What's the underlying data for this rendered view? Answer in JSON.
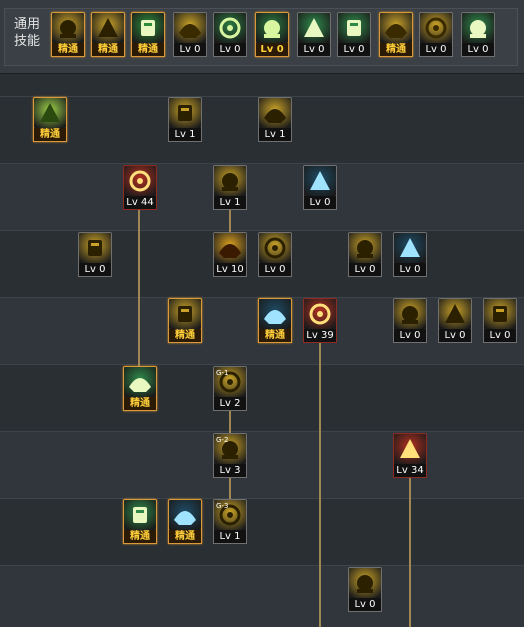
{
  "header": {
    "common_skills_label": "通用技能"
  },
  "common_skills": [
    {
      "name": "common-skill-1-icon",
      "label": "精通",
      "elite": true,
      "bg": "#c9a227",
      "fg": "#2b2100"
    },
    {
      "name": "common-skill-2-icon",
      "label": "精通",
      "elite": true,
      "bg": "#c9a227",
      "fg": "#2b2100"
    },
    {
      "name": "common-skill-3-icon",
      "label": "精通",
      "elite": true,
      "bg": "#2f8a3a",
      "fg": "#e9f7c0"
    },
    {
      "name": "common-skill-4-icon",
      "label": "Lv 0",
      "elite": false,
      "bg": "#c9a227",
      "fg": "#3a2a00"
    },
    {
      "name": "common-skill-5-icon",
      "label": "Lv 0",
      "elite": false,
      "bg": "#2b7a40",
      "fg": "#d8f5a0"
    },
    {
      "name": "common-skill-6-icon",
      "label": "Lv 0",
      "elite": true,
      "bg": "#2b7a40",
      "fg": "#d8f5a0"
    },
    {
      "name": "common-skill-7-icon",
      "label": "Lv 0",
      "elite": false,
      "bg": "#2f8a4a",
      "fg": "#e9f7c0"
    },
    {
      "name": "common-skill-8-icon",
      "label": "Lv 0",
      "elite": false,
      "bg": "#2f8a4a",
      "fg": "#e9f7c0"
    },
    {
      "name": "common-skill-9-icon",
      "label": "精通",
      "elite": true,
      "bg": "#c9a227",
      "fg": "#3a2a00"
    },
    {
      "name": "common-skill-10-icon",
      "label": "Lv 0",
      "elite": false,
      "bg": "#c9a227",
      "fg": "#3a2a00"
    },
    {
      "name": "common-skill-11-icon",
      "label": "Lv 0",
      "elite": false,
      "bg": "#2f8a4a",
      "fg": "#e9f7c0"
    }
  ],
  "tree_skills": [
    {
      "name": "skill-row1-a",
      "label": "精通",
      "elite": true,
      "red": false,
      "bg": "#9bd14a",
      "fg": "#2a4a10"
    },
    {
      "name": "skill-row1-b",
      "label": "Lv 1",
      "elite": false,
      "red": false,
      "bg": "#c9a227",
      "fg": "#2b2100"
    },
    {
      "name": "skill-row1-c",
      "label": "Lv 1",
      "elite": false,
      "red": false,
      "bg": "#c9a227",
      "fg": "#2b2100"
    },
    {
      "name": "skill-row2-a",
      "label": "Lv 44",
      "elite": false,
      "red": true,
      "bg": "#b33020",
      "fg": "#ffe07a"
    },
    {
      "name": "skill-row2-b",
      "label": "Lv 1",
      "elite": false,
      "red": false,
      "bg": "#c9a227",
      "fg": "#2b2100"
    },
    {
      "name": "skill-row2-c",
      "label": "Lv 0",
      "elite": false,
      "red": false,
      "bg": "#1e4c66",
      "fg": "#9fe3ff"
    },
    {
      "name": "skill-row3-a",
      "label": "Lv 0",
      "elite": false,
      "red": false,
      "bg": "#c9a227",
      "fg": "#2b2100"
    },
    {
      "name": "skill-row3-b",
      "label": "Lv 10",
      "elite": false,
      "red": false,
      "bg": "#d9a020",
      "fg": "#3a1a00"
    },
    {
      "name": "skill-row3-c",
      "label": "Lv 0",
      "elite": false,
      "red": false,
      "bg": "#c9a227",
      "fg": "#2b2100"
    },
    {
      "name": "skill-row3-d",
      "label": "Lv 0",
      "elite": false,
      "red": false,
      "bg": "#c9a227",
      "fg": "#2b2100"
    },
    {
      "name": "skill-row3-e",
      "label": "Lv 0",
      "elite": false,
      "red": false,
      "bg": "#1e4c66",
      "fg": "#9fe3ff"
    },
    {
      "name": "skill-row4-a",
      "label": "精通",
      "elite": true,
      "red": false,
      "bg": "#c9a227",
      "fg": "#2b2100"
    },
    {
      "name": "skill-row4-b",
      "label": "精通",
      "elite": true,
      "red": false,
      "bg": "#1e4c66",
      "fg": "#9fe3ff"
    },
    {
      "name": "skill-row4-c",
      "label": "Lv 39",
      "elite": false,
      "red": true,
      "bg": "#b33020",
      "fg": "#ffe07a"
    },
    {
      "name": "skill-row4-d",
      "label": "Lv 0",
      "elite": false,
      "red": false,
      "bg": "#c9a227",
      "fg": "#2b2100"
    },
    {
      "name": "skill-row4-e",
      "label": "Lv 0",
      "elite": false,
      "red": false,
      "bg": "#c9a227",
      "fg": "#2b2100"
    },
    {
      "name": "skill-row4-f",
      "label": "Lv 0",
      "elite": false,
      "red": false,
      "bg": "#c9a227",
      "fg": "#2b2100"
    },
    {
      "name": "skill-row5-a",
      "label": "精通",
      "elite": true,
      "red": false,
      "bg": "#2f8a4a",
      "fg": "#e9f7c0"
    },
    {
      "name": "skill-row5-b",
      "label": "Lv 2",
      "elite": false,
      "red": false,
      "bg": "#c9a227",
      "fg": "#2b2100",
      "tag": "G-1"
    },
    {
      "name": "skill-row6-a",
      "label": "Lv 3",
      "elite": false,
      "red": false,
      "bg": "#c9a227",
      "fg": "#2b2100",
      "tag": "G-2"
    },
    {
      "name": "skill-row6-b",
      "label": "Lv 34",
      "elite": false,
      "red": true,
      "bg": "#b33020",
      "fg": "#ffe07a"
    },
    {
      "name": "skill-row7-a",
      "label": "精通",
      "elite": true,
      "red": false,
      "bg": "#2f8a4a",
      "fg": "#e9f7c0"
    },
    {
      "name": "skill-row7-b",
      "label": "精通",
      "elite": true,
      "red": false,
      "bg": "#1e4c66",
      "fg": "#9fe3ff"
    },
    {
      "name": "skill-row7-c",
      "label": "Lv 1",
      "elite": false,
      "red": false,
      "bg": "#c9a227",
      "fg": "#2b2100",
      "tag": "G-3"
    },
    {
      "name": "skill-row8-a",
      "label": "Lv 0",
      "elite": false,
      "red": false,
      "bg": "#c9a227",
      "fg": "#2b2100"
    }
  ]
}
